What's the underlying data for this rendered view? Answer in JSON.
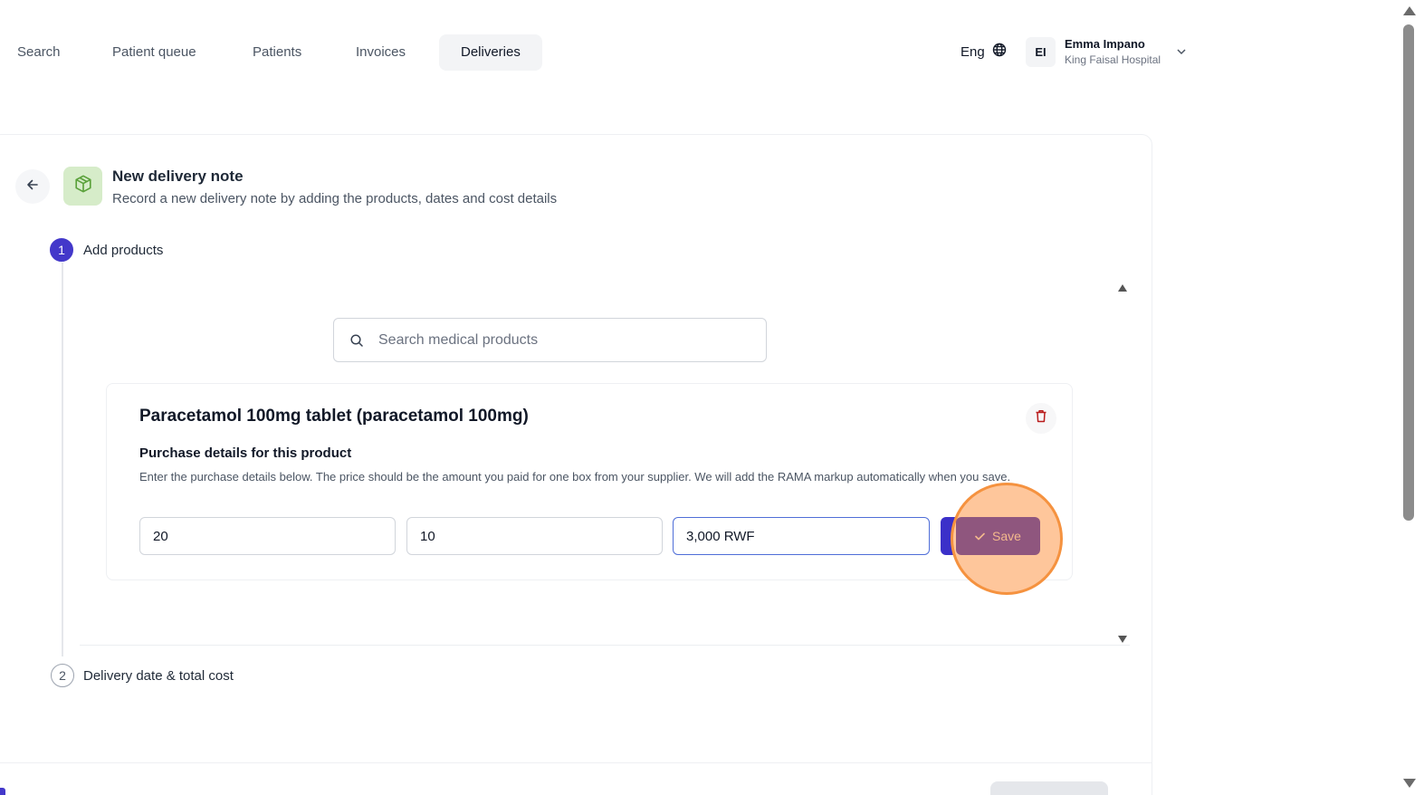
{
  "nav": {
    "items": [
      {
        "label": "Search"
      },
      {
        "label": "Patient queue"
      },
      {
        "label": "Patients"
      },
      {
        "label": "Invoices"
      },
      {
        "label": "Deliveries",
        "active": true
      }
    ]
  },
  "header": {
    "language": "Eng",
    "user": {
      "initials": "EI",
      "name": "Emma Impano",
      "organization": "King Faisal Hospital"
    }
  },
  "page": {
    "title": "New delivery note",
    "subtitle": "Record a new delivery note by adding the products, dates and cost details",
    "icon": "box-icon"
  },
  "steps": [
    {
      "number": "1",
      "label": "Add products",
      "status": "active"
    },
    {
      "number": "2",
      "label": "Delivery date & total cost",
      "status": "pending"
    }
  ],
  "search": {
    "placeholder": "Search medical products"
  },
  "product": {
    "name": "Paracetamol 100mg tablet (paracetamol 100mg)",
    "details_title": "Purchase details for this product",
    "details_description": "Enter the purchase details below. The price should be the amount you paid for one box from your supplier. We will add the RAMA markup automatically when you save.",
    "fields": {
      "quantity": "20",
      "units": "10",
      "price": "3,000 RWF"
    },
    "save_label": "Save"
  },
  "colors": {
    "primary": "#4338ca",
    "icon_badge_bg": "#d6ecc9",
    "icon_badge_fg": "#5aa13a",
    "delete_icon": "#b91c1c",
    "click_highlight": "#f5923f"
  }
}
